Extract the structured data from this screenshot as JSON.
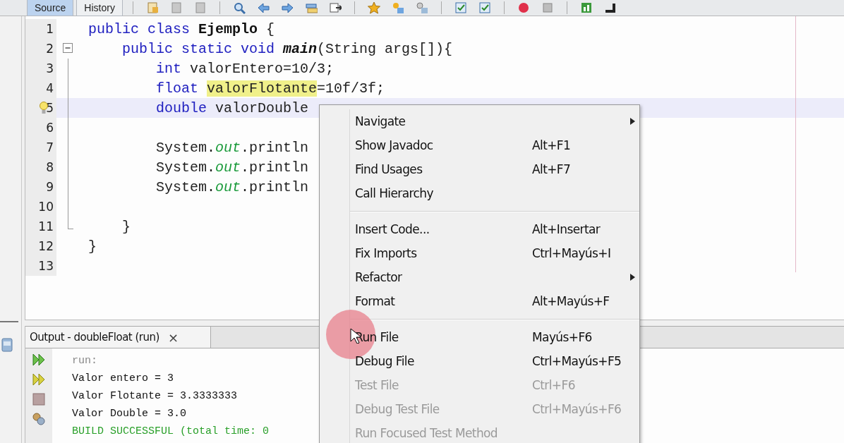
{
  "editor_tabs": [
    {
      "label": "Source",
      "selected": true
    },
    {
      "label": "History",
      "selected": false
    }
  ],
  "code_lines": [
    {
      "number": "1",
      "kind": "plain",
      "hint": false,
      "current": false,
      "tokens": [
        {
          "text": "public class ",
          "kind": "keyword"
        },
        {
          "text": "Ejemplo",
          "kind": "class"
        },
        {
          "text": " {",
          "kind": "plain"
        }
      ]
    },
    {
      "number": "2",
      "kind": "opener",
      "hint": false,
      "current": false,
      "tokens": [
        {
          "text": "    public static void ",
          "kind": "keyword"
        },
        {
          "text": "main",
          "kind": "method"
        },
        {
          "text": "(String args[]){",
          "kind": "plain"
        }
      ]
    },
    {
      "number": "3",
      "kind": "body",
      "hint": false,
      "current": false,
      "tokens": [
        {
          "text": "        int ",
          "kind": "keyword"
        },
        {
          "text": "valorEntero=10/3;",
          "kind": "plain"
        }
      ]
    },
    {
      "number": "4",
      "kind": "body",
      "hint": false,
      "current": false,
      "tokens": [
        {
          "text": "        float ",
          "kind": "keyword"
        },
        {
          "text": "valorFlotante",
          "kind": "marked"
        },
        {
          "text": "=10f/3f;",
          "kind": "plain"
        }
      ]
    },
    {
      "number": "5",
      "kind": "body",
      "hint": true,
      "current": true,
      "tokens": [
        {
          "text": "        double ",
          "kind": "keyword"
        },
        {
          "text": "valorDouble",
          "kind": "plain"
        }
      ]
    },
    {
      "number": "6",
      "kind": "body",
      "hint": false,
      "current": false
    },
    {
      "number": "7",
      "kind": "body",
      "hint": false,
      "current": false,
      "tokens": [
        {
          "text": "        System.",
          "kind": "plain"
        },
        {
          "text": "out",
          "kind": "field"
        },
        {
          "text": ".println",
          "kind": "plain"
        }
      ]
    },
    {
      "number": "8",
      "kind": "body",
      "hint": false,
      "current": false,
      "tokens": [
        {
          "text": "        System.",
          "kind": "plain"
        },
        {
          "text": "out",
          "kind": "field"
        },
        {
          "text": ".println",
          "kind": "plain"
        }
      ]
    },
    {
      "number": "9",
      "kind": "body",
      "hint": false,
      "current": false,
      "tokens": [
        {
          "text": "        System.",
          "kind": "plain"
        },
        {
          "text": "out",
          "kind": "field"
        },
        {
          "text": ".println",
          "kind": "plain"
        }
      ]
    },
    {
      "number": "10",
      "kind": "body",
      "hint": false,
      "current": false
    },
    {
      "number": "11",
      "kind": "closer",
      "hint": false,
      "current": false,
      "tokens": [
        {
          "text": "    }",
          "kind": "plain"
        }
      ]
    },
    {
      "number": "12",
      "kind": "plain",
      "hint": false,
      "current": false,
      "tokens": [
        {
          "text": "}",
          "kind": "plain"
        }
      ]
    },
    {
      "number": "13",
      "kind": "plain",
      "hint": false,
      "current": false
    }
  ],
  "context_menu": {
    "groups": [
      [
        {
          "label": "Navigate",
          "submenu": true,
          "disabled": false
        },
        {
          "label": "Show Javadoc",
          "shortcut": "Alt+F1",
          "submenu": false,
          "disabled": false
        },
        {
          "label": "Find Usages",
          "shortcut": "Alt+F7",
          "submenu": false,
          "disabled": false
        },
        {
          "label": "Call Hierarchy",
          "submenu": false,
          "disabled": false
        }
      ],
      [
        {
          "label": "Insert Code...",
          "shortcut": "Alt+Insertar",
          "submenu": false,
          "disabled": false
        },
        {
          "label": "Fix Imports",
          "shortcut": "Ctrl+Mayús+I",
          "submenu": false,
          "disabled": false
        },
        {
          "label": "Refactor",
          "submenu": true,
          "disabled": false
        },
        {
          "label": "Format",
          "shortcut": "Alt+Mayús+F",
          "submenu": false,
          "disabled": false
        }
      ],
      [
        {
          "label": "Run File",
          "shortcut": "Mayús+F6",
          "submenu": false,
          "disabled": false,
          "clicked": true
        },
        {
          "label": "Debug File",
          "shortcut": "Ctrl+Mayús+F5",
          "submenu": false,
          "disabled": false
        },
        {
          "label": "Test File",
          "shortcut": "Ctrl+F6",
          "submenu": false,
          "disabled": true
        },
        {
          "label": "Debug Test File",
          "shortcut": "Ctrl+Mayús+F6",
          "submenu": false,
          "disabled": true
        },
        {
          "label": "Run Focused Test Method",
          "submenu": false,
          "disabled": true
        }
      ]
    ]
  },
  "output": {
    "title": "Output - doubleFloat (run)",
    "close": "×",
    "lines": [
      {
        "text": "run:",
        "kind": "meta"
      },
      {
        "text": "Valor entero = 3",
        "kind": "plain"
      },
      {
        "text": "Valor Flotante = 3.3333333",
        "kind": "plain"
      },
      {
        "text": "Valor Double = 3.0",
        "kind": "plain"
      },
      {
        "text": "BUILD SUCCESSFUL (total time: 0",
        "kind": "success"
      }
    ]
  }
}
